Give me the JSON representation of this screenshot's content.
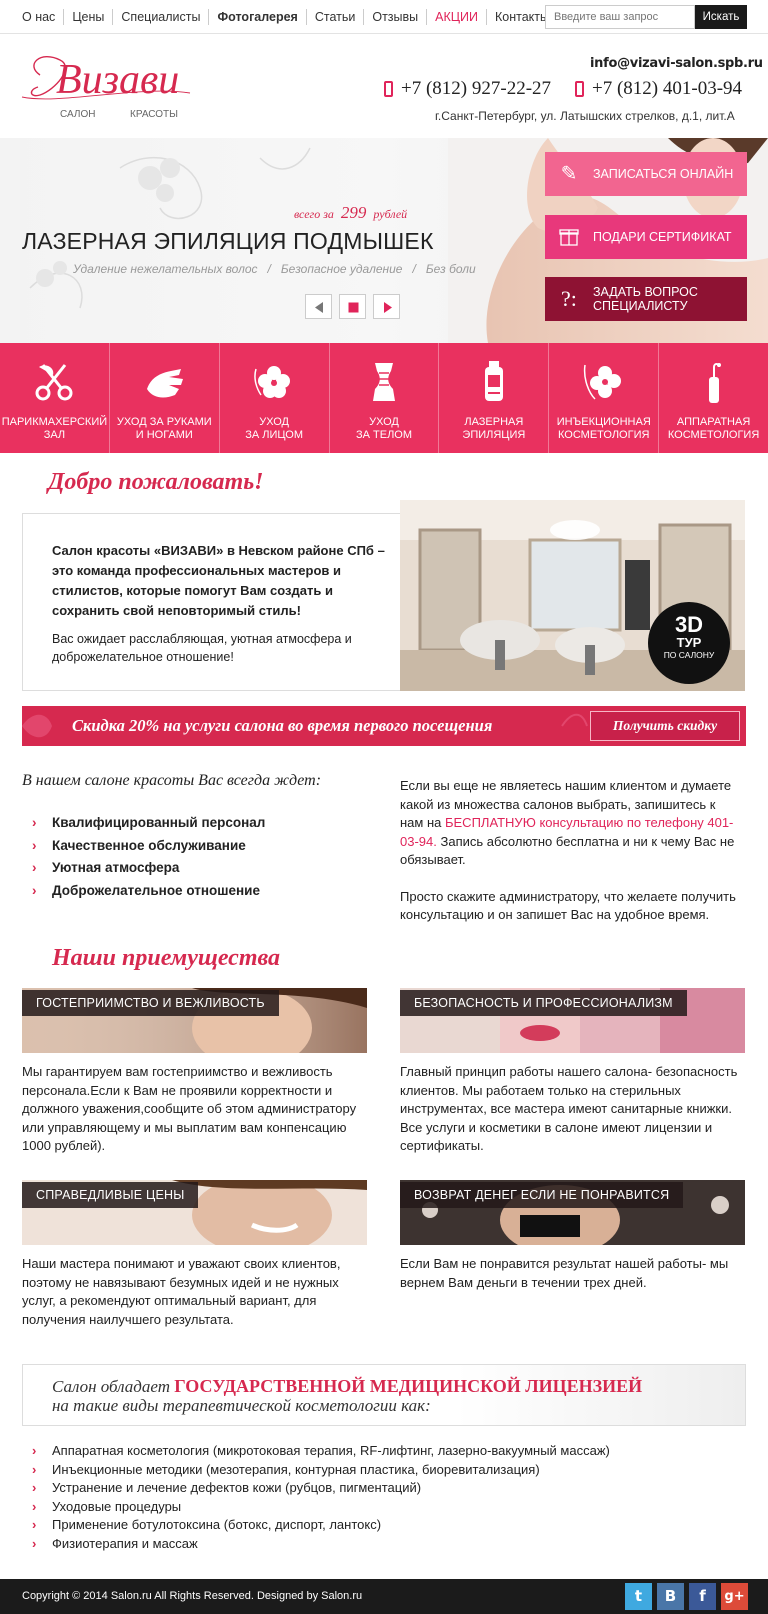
{
  "topnav": {
    "items": [
      {
        "label": "О нас"
      },
      {
        "label": "Цены"
      },
      {
        "label": "Специалисты"
      },
      {
        "label": "Фотогалерея"
      },
      {
        "label": "Статьи"
      },
      {
        "label": "Отзывы"
      },
      {
        "label": "АКЦИИ"
      },
      {
        "label": "Контакты"
      }
    ],
    "search_placeholder": "Введите ваш запрос",
    "search_button": "Искать"
  },
  "header": {
    "logo_text": "Визави",
    "logo_sub_left": "САЛОН",
    "logo_sub_right": "КРАСОТЫ",
    "email": "info@vizavi-salon.spb.ru",
    "phone1": "+7 (812) 927-22-27",
    "phone2": "+7 (812) 401-03-94",
    "address": "г.Санкт-Петербург, ул. Латышских стрелков,  д.1, лит.А"
  },
  "hero": {
    "promo_prefix": "всего за",
    "promo_price": "299",
    "promo_suffix": "рублей",
    "title": "ЛАЗЕРНАЯ ЭПИЛЯЦИЯ ПОДМЫШЕК",
    "sub": [
      "Удаление нежелательных волос",
      "/",
      "Безопасное удаление",
      "/",
      "Без боли"
    ],
    "cta": [
      {
        "label": "ЗАПИСАТЬСЯ ОНЛАЙН",
        "icon": "pencil-icon",
        "color": "#f26590"
      },
      {
        "label": "ПОДАРИ СЕРТИФИКАТ",
        "icon": "gift-icon",
        "color": "#e8387b"
      },
      {
        "label": "ЗАДАТЬ ВОПРОС\nСПЕЦИАЛИСТУ",
        "icon": "question-icon",
        "color": "#8e1233"
      }
    ]
  },
  "services": [
    {
      "label": "ПАРИКМАХЕРСКИЙ\nЗАЛ",
      "icon": "scissors-icon"
    },
    {
      "label": "УХОД ЗА РУКАМИ\nИ НОГАМИ",
      "icon": "hand-icon"
    },
    {
      "label": "УХОД\nЗА ЛИЦОМ",
      "icon": "flower-face-icon"
    },
    {
      "label": "УХОД\nЗА ТЕЛОМ",
      "icon": "corset-icon"
    },
    {
      "label": "ЛАЗЕРНАЯ\nЭПИЛЯЦИЯ",
      "icon": "laser-device-icon"
    },
    {
      "label": "ИНЪЕКЦИОННАЯ\nКОСМЕТОЛОГИЯ",
      "icon": "injection-flower-icon"
    },
    {
      "label": "АППАРАТНАЯ\nКОСМЕТОЛОГИЯ",
      "icon": "apparatus-icon"
    }
  ],
  "welcome": {
    "title": "Добро пожаловать!",
    "p1": "Салон красоты «ВИЗАВИ» в Невском районе СПб – это команда профессиональных мастеров и стилистов, которые помогут Вам создать и сохранить свой неповторимый стиль!",
    "p2": "Вас ожидает расслабляющая, уютная атмосфера и доброжелательное отношение!",
    "tour_big": "3D",
    "tour_mid": "ТУР",
    "tour_small": "ПО САЛОНУ"
  },
  "discount": {
    "text": "Скидка 20% на услуги салона во время первого посещения",
    "button": "Получить скидку"
  },
  "awaits": {
    "title": "В нашем салоне красоты Вас всегда ждет:",
    "items": [
      "Квалифицированный персонал",
      "Качественное обслуживание",
      "Уютная атмосфера",
      "Доброжелательное отношение"
    ],
    "r1": "Если вы еще не являетесь нашим клиентом и думаете какой из множества салонов выбрать, запишитесь к нам на ",
    "r_link": "БЕСПЛАТНУЮ консультацию по телефону 401-03-94.",
    "r2": " Запись абсолютно бесплатна и ни к чему Вас не обязывает.",
    "r3": "Просто скажите администратору, что желаете получить консультацию и он запишет Вас на удобное время."
  },
  "advantages": {
    "title": "Наши приемущества",
    "items": [
      {
        "label": "ГОСТЕПРИИМСТВО И ВЕЖЛИВОСТЬ",
        "text": "Мы гарантируем вам гостеприимство и вежливость персонала.Если к Вам не проявили корректности и должного уважения,сообщите об этом администратору или управляющему и мы выплатим вам конпенсацию 1000 рублей)."
      },
      {
        "label": "БЕЗОПАСНОСТЬ И ПРОФЕССИОНАЛИЗМ",
        "text": "Главный принцип работы нашего салона- безопасность клиентов. Мы работаем только на стерильных инструментах, все мастера имеют санитарные книжки. Все услуги и косметики в салоне имеют лицензии и сертификаты."
      },
      {
        "label": "СПРАВЕДЛИВЫЕ ЦЕНЫ",
        "text": "Наши мастера понимают и уважают своих клиентов, поэтому не навязывают безумных идей и не нужных услуг, а рекомендуют оптимальный вариант, для получения наилучшего результата."
      },
      {
        "label": "ВОЗВРАТ ДЕНЕГ ЕСЛИ НЕ ПОНРАВИТСЯ",
        "text": "Если Вам не понравится результат нашей работы- мы вернем Вам деньги в течении трех дней."
      }
    ]
  },
  "license": {
    "t1a": "Салон обладает ",
    "t1b": "ГОСУДАРСТВЕННОЙ МЕДИЦИНСКОЙ ЛИЦЕНЗИЕЙ",
    "t2": "на такие виды терапевтической косметологии как:",
    "items": [
      "Аппаратная косметология (микротоковая терапия, RF-лифтинг, лазерно-вакуумный массаж)",
      "Инъекционные методики (мезотерапия, контурная пластика, биоревитализация)",
      "Устранение и лечение дефектов кожи (рубцов, пигментаций)",
      "Уходовые процедуры",
      "Применение ботулотоксина (ботокс, диспорт, лантокс)",
      "Физиотерапия и массаж"
    ]
  },
  "footer": {
    "copyright": "Copyright © 2014 Salon.ru All Rights Reserved. Designed by Salon.ru",
    "social": [
      {
        "glyph": "t",
        "icon": "twitter-icon",
        "color": "#3fa9e0"
      },
      {
        "glyph": "B",
        "icon": "vk-icon",
        "color": "#4a76a8"
      },
      {
        "glyph": "f",
        "icon": "facebook-icon",
        "color": "#3b5998"
      },
      {
        "glyph": "g+",
        "icon": "google-plus-icon",
        "color": "#dd4b39"
      }
    ]
  }
}
